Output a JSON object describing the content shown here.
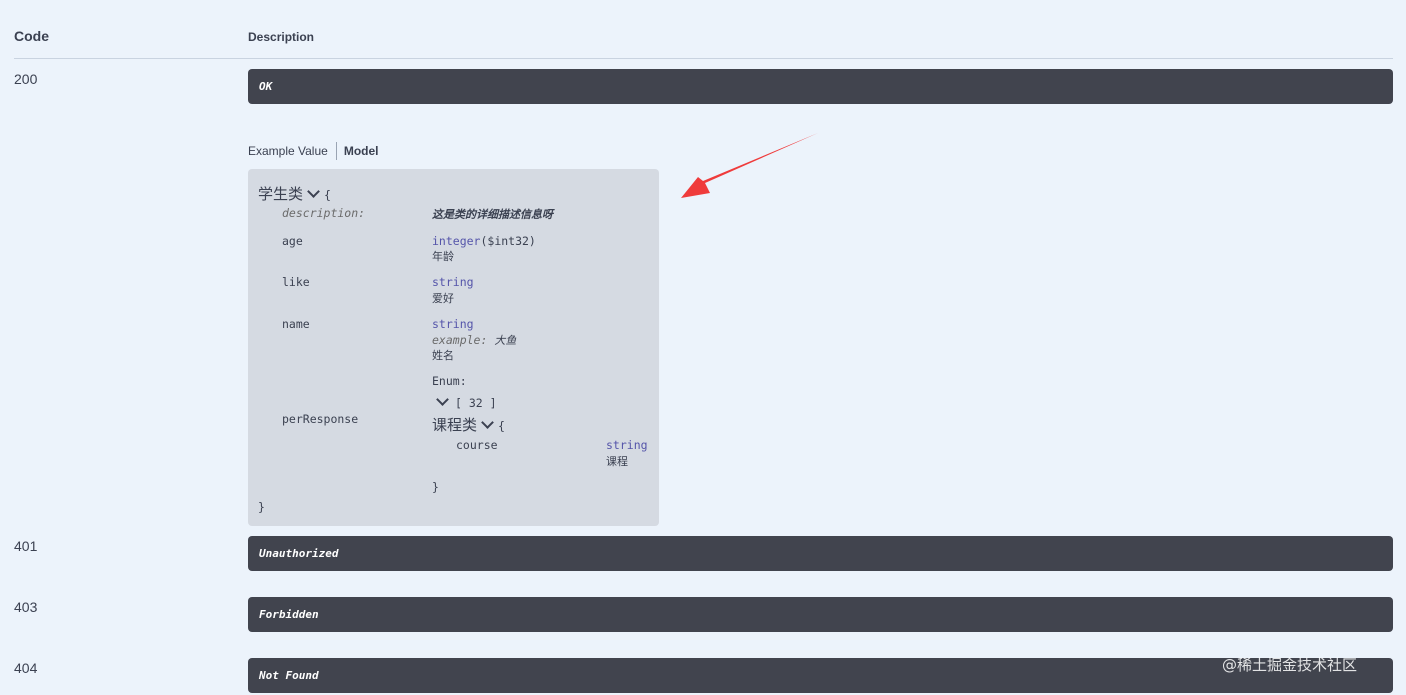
{
  "header": {
    "code_label": "Code",
    "description_label": "Description"
  },
  "responses": [
    {
      "code": "200",
      "description": "OK"
    },
    {
      "code": "401",
      "description": "Unauthorized"
    },
    {
      "code": "403",
      "description": "Forbidden"
    },
    {
      "code": "404",
      "description": "Not Found"
    }
  ],
  "tabs": {
    "example_value": "Example Value",
    "model": "Model"
  },
  "model": {
    "title": "学生类",
    "open_brace": "{",
    "close_brace": "}",
    "description_key": "description:",
    "description_value": "这是类的详细描述信息呀",
    "properties": [
      {
        "name": "age",
        "type": "integer",
        "format": "($int32)",
        "desc": "年龄"
      },
      {
        "name": "like",
        "type": "string",
        "desc": "爱好"
      },
      {
        "name": "name",
        "type": "string",
        "example_label": "example:",
        "example_value": "大鱼",
        "desc": "姓名",
        "enum_label": "Enum:"
      },
      {
        "name": "perResponse",
        "array_label": "[ 32 ]"
      }
    ],
    "nested": {
      "title": "课程类",
      "open_brace": "{",
      "close_brace": "}",
      "prop_name": "course",
      "prop_type": "string",
      "prop_desc": "课程"
    }
  },
  "colors": {
    "background": "#ecf3fb",
    "description_bar": "#41444e",
    "model_box": "#d5dae2",
    "arrow": "#ef3b3b",
    "type_text": "#5555aa"
  },
  "watermark": "@稀土掘金技术社区"
}
